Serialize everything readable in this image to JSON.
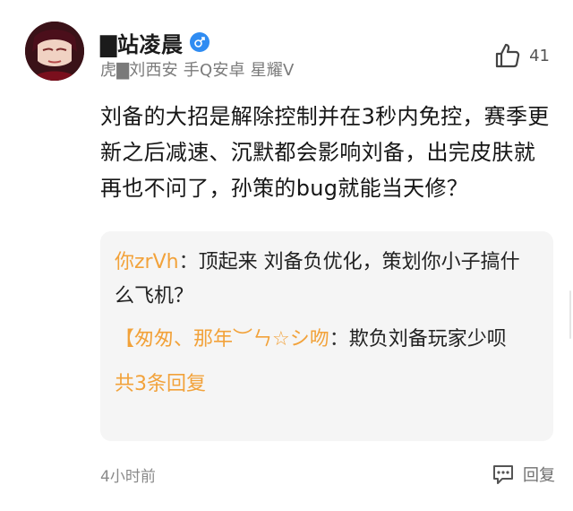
{
  "header": {
    "username": "▇站凌晨",
    "meta": "虎▇刘西安 手Q安卓 星耀V",
    "like_count": "41"
  },
  "comment": {
    "text": "刘备的大招是解除控制并在3秒内免控，赛季更新之后减速、沉默都会影响刘备，出完皮肤就再也不问了，孙策的bug就能当天修？"
  },
  "replies": {
    "items": [
      {
        "author": "你zrVh",
        "sep": "：",
        "text": "顶起来 刘备负优化，策划你小子搞什么飞机？"
      },
      {
        "author": "【匆匆、那年︶ㄣ☆シ吻",
        "sep": "：",
        "text": "欺负刘备玩家少呗"
      }
    ],
    "view_all": "共3条回复"
  },
  "footer": {
    "time": "4小时前",
    "reply_label": "回复"
  },
  "colors": {
    "accent_orange": "#f2a23a",
    "gender_blue": "#2f8cf2",
    "reply_bg": "#f5f5f5"
  },
  "icons": {
    "gender": "male-icon",
    "like": "thumbs-up-icon",
    "reply": "chat-bubble-icon"
  }
}
